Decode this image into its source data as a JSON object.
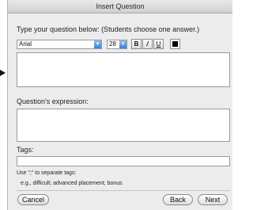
{
  "window": {
    "title": "Insert Question"
  },
  "question": {
    "prompt_label": "Type your question below: (Students choose one answer.)",
    "text": ""
  },
  "toolbar": {
    "font": "Arial",
    "font_size": "28",
    "chevron": "▼",
    "bold": "B",
    "italic": "/",
    "underline": "U",
    "color": "#000000"
  },
  "expression": {
    "label": "Question's expression:",
    "text": ""
  },
  "tags": {
    "label": "Tags:",
    "value": "",
    "help": "Use \";\" to separate tags:",
    "example": "e.g., difficult; advanced placement; bonus"
  },
  "buttons": {
    "cancel": "Cancel",
    "back": "Back",
    "next": "Next"
  }
}
